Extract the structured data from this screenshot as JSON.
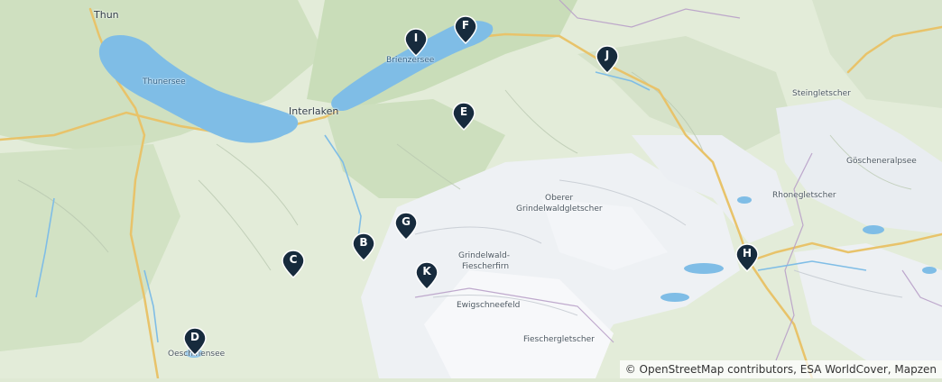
{
  "map": {
    "places": {
      "thun": "Thun",
      "thunersee": "Thunersee",
      "interlaken": "Interlaken",
      "brienzersee": "Brienzersee",
      "steingletscher": "Steingletscher",
      "goescheneralpsee": "Göscheneralpsee",
      "rhonegletscher": "Rhonegletscher",
      "oberer_grindelwaldgletscher_1": "Oberer",
      "oberer_grindelwaldgletscher_2": "Grindelwaldgletscher",
      "grindelwald_fiescherfirn_1": "Grindelwald-",
      "grindelwald_fiescherfirn_2": "Fiescherfirn",
      "ewigschneefeld": "Ewigschneefeld",
      "fieschergletscher": "Fieschergletscher",
      "oeschinensee": "Oeschinensee"
    },
    "markers": [
      {
        "id": "B",
        "label": "B"
      },
      {
        "id": "C",
        "label": "C"
      },
      {
        "id": "D",
        "label": "D"
      },
      {
        "id": "E",
        "label": "E"
      },
      {
        "id": "F",
        "label": "F"
      },
      {
        "id": "G",
        "label": "G"
      },
      {
        "id": "H",
        "label": "H"
      },
      {
        "id": "I",
        "label": "I"
      },
      {
        "id": "J",
        "label": "J"
      },
      {
        "id": "K",
        "label": "K"
      }
    ],
    "attribution": "© OpenStreetMap contributors, ESA WorldCover, Mapzen",
    "colors": {
      "water": "#7fbde6",
      "forest": "#c6dbb8",
      "land": "#e3ecd9",
      "glacier": "#f4f6f8",
      "marker": "#172b3d"
    }
  }
}
